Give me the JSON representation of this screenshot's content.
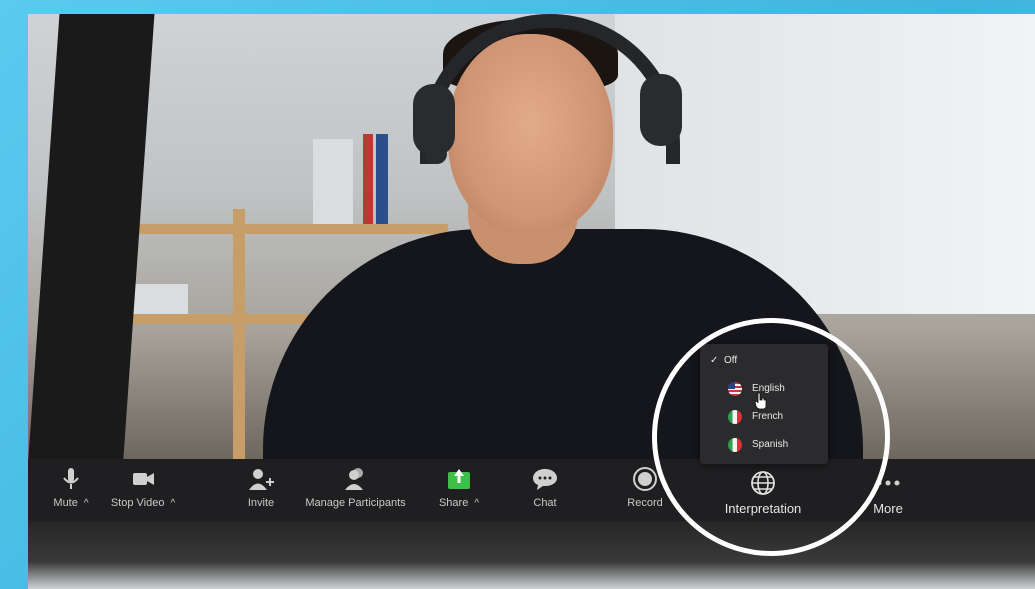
{
  "toolbar": {
    "mute": {
      "label": "Mute",
      "icon": "microphone-icon"
    },
    "stop_video": {
      "label": "Stop Video",
      "icon": "video-camera-icon"
    },
    "invite": {
      "label": "Invite",
      "icon": "add-person-icon"
    },
    "manage_participants": {
      "label": "Manage Participants",
      "icon": "participants-icon"
    },
    "share": {
      "label": "Share",
      "icon": "share-screen-icon",
      "accent": "#3fbf4a"
    },
    "chat": {
      "label": "Chat",
      "icon": "chat-bubble-icon"
    },
    "record": {
      "label": "Record",
      "icon": "record-icon"
    },
    "interpretation": {
      "label": "Interpretation",
      "icon": "globe-icon"
    },
    "more": {
      "label": "More",
      "icon": "more-dots-icon"
    }
  },
  "interpretation_menu": {
    "items": [
      {
        "label": "Off",
        "selected": true
      },
      {
        "label": "English",
        "flag": "us-flag-icon",
        "selected": false
      },
      {
        "label": "French",
        "flag": "france-flag-icon",
        "selected": false
      },
      {
        "label": "Spanish",
        "flag": "italy-flag-icon",
        "selected": false
      }
    ],
    "caret": "^",
    "check": "✓"
  },
  "colors": {
    "background": "#4fc3e8",
    "toolbar": "#1f1f21",
    "menu": "#2b2b2d",
    "share_green": "#3fbf4a",
    "highlight_circle": "#ffffff"
  }
}
